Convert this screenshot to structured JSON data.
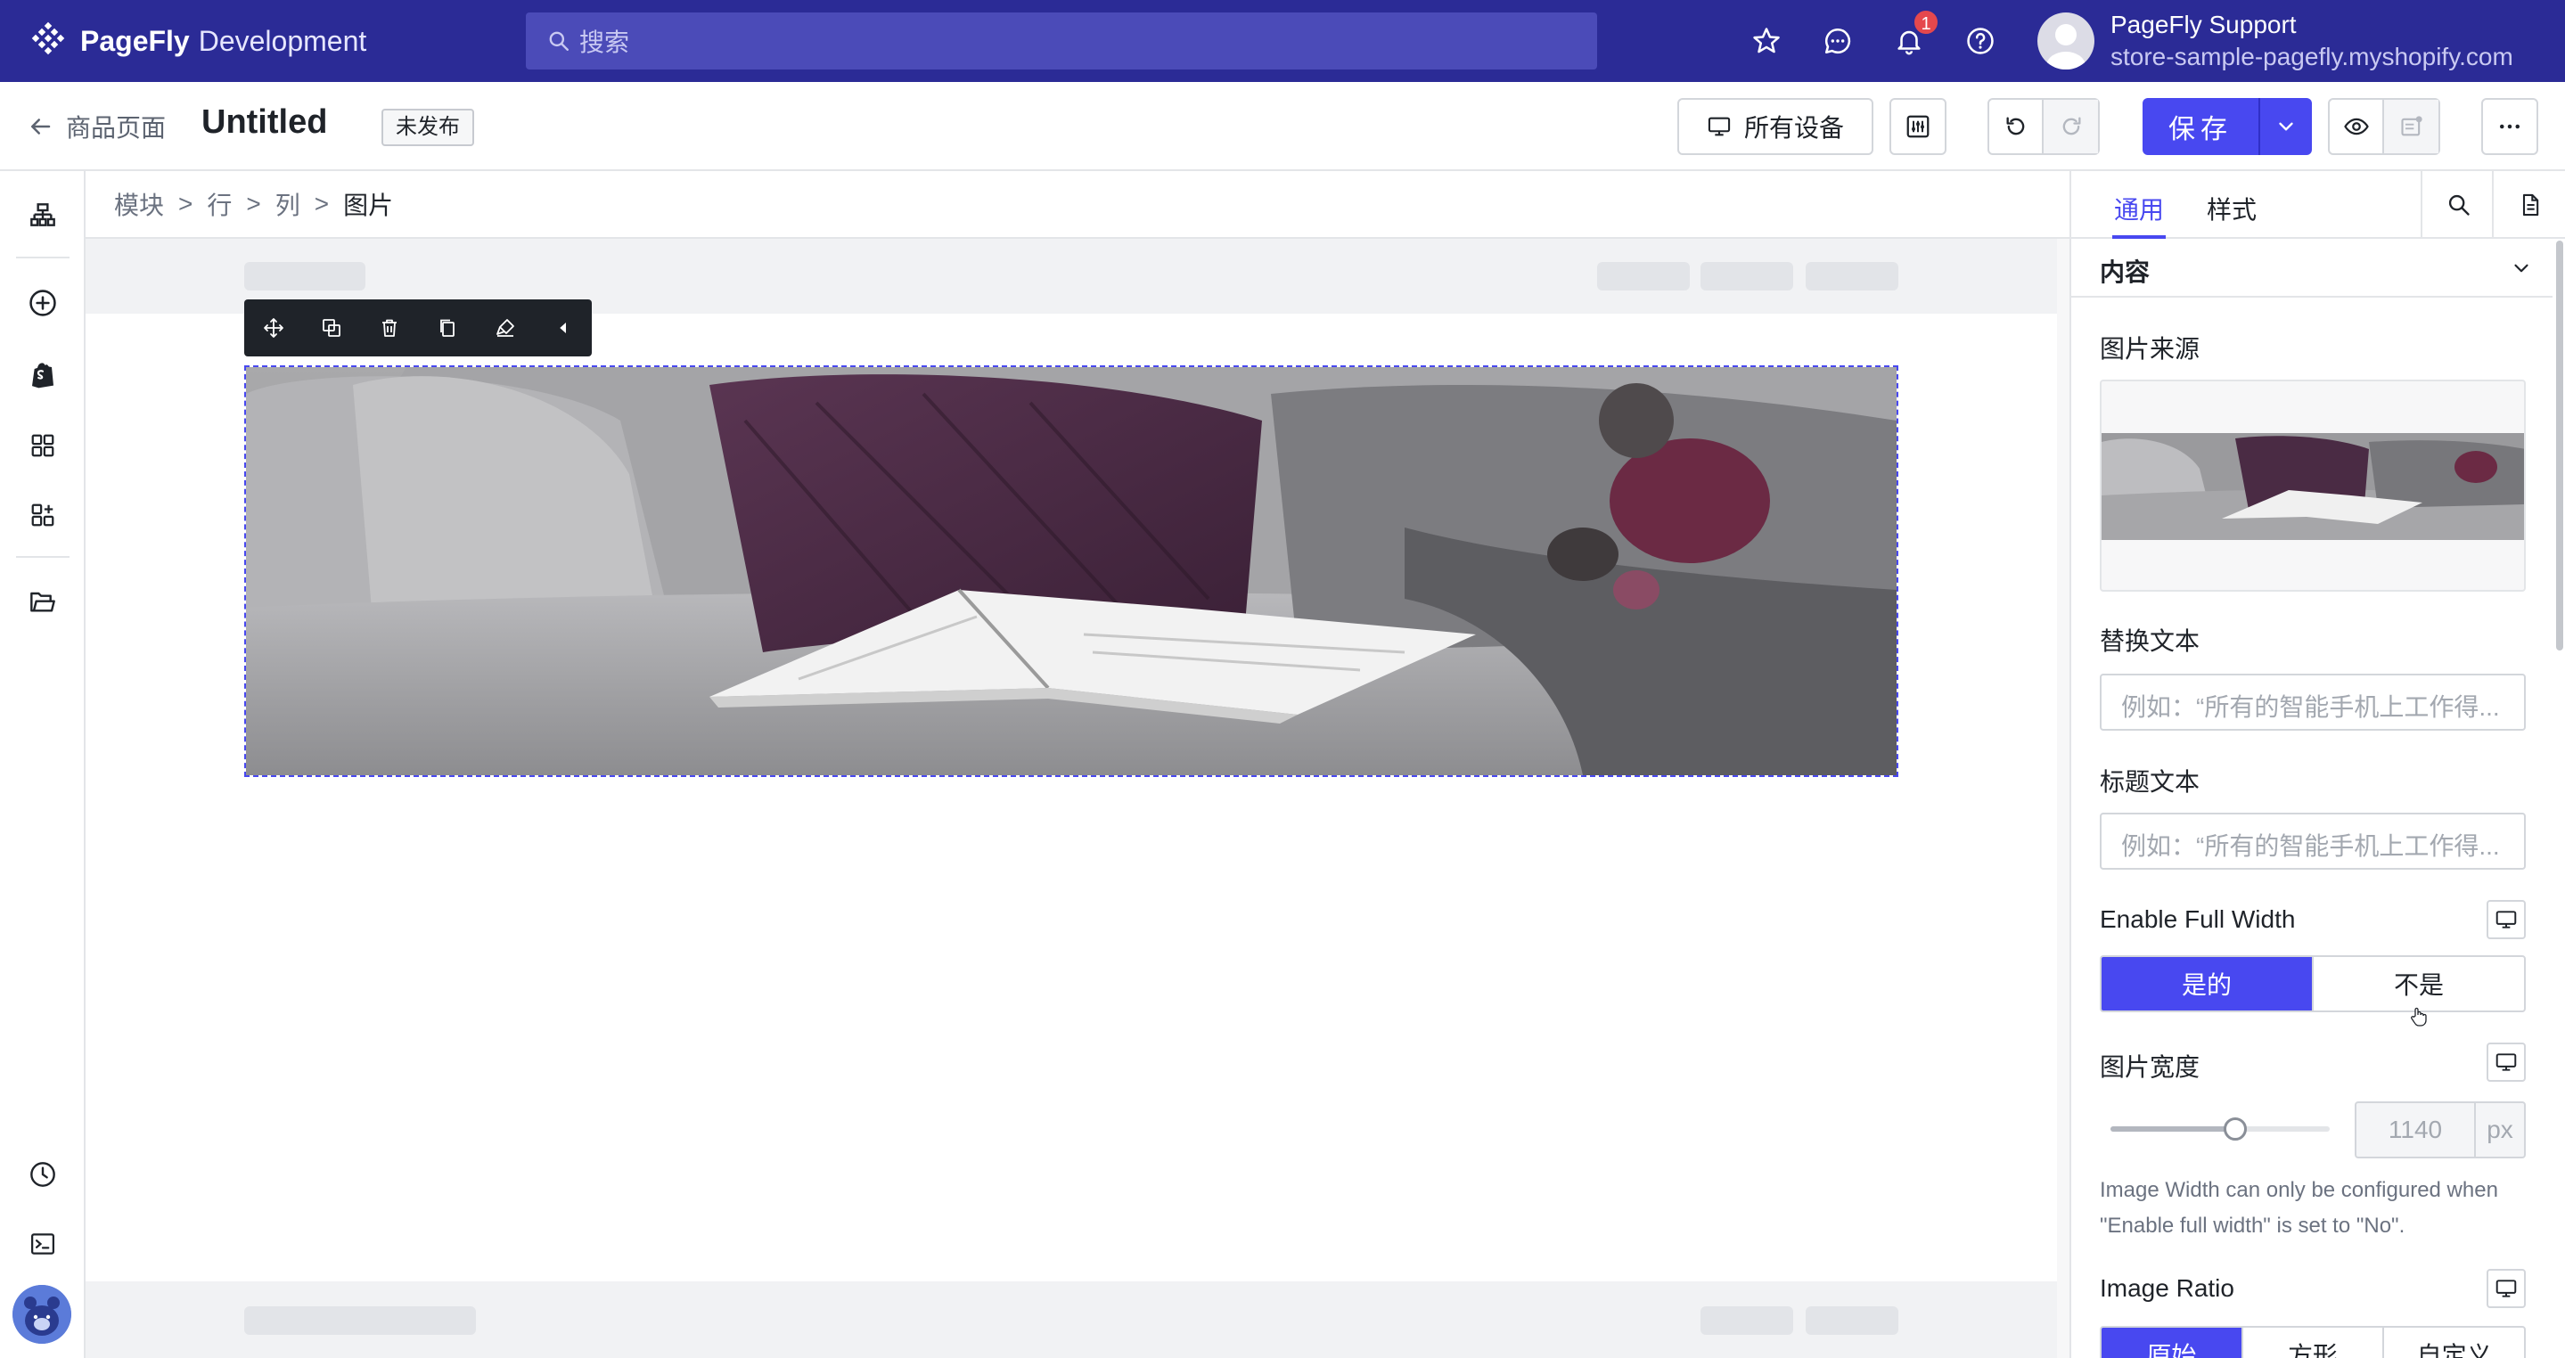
{
  "app": {
    "logo_text": "PageFly",
    "logo_sub": "Development",
    "search_placeholder": "搜索",
    "notification_count": "1",
    "user_name": "PageFly Support",
    "user_store": "store-sample-pagefly.myshopify.com"
  },
  "header": {
    "back_label": "商品页面",
    "title": "Untitled",
    "status": "未发布",
    "device_label": "所有设备",
    "save_label": "保存"
  },
  "breadcrumb": {
    "items": [
      "模块",
      "行",
      "列"
    ],
    "current": "图片"
  },
  "panel": {
    "tabs": [
      "通用",
      "样式"
    ],
    "section_title": "内容",
    "image_source_label": "图片来源",
    "alt_text_label": "替换文本",
    "alt_text_placeholder": "例如：“所有的智能手机上工作得...",
    "title_text_label": "标题文本",
    "title_text_placeholder": "例如：“所有的智能手机上工作得...",
    "full_width_label": "Enable Full Width",
    "full_width_options": [
      "是的",
      "不是"
    ],
    "full_width_selected": "是的",
    "image_width_label": "图片宽度",
    "image_width_value": "1140",
    "image_width_unit": "px",
    "image_width_slider_fraction": 0.57,
    "image_width_hint": "Image Width can only be configured when \"Enable full width\" is set to \"No\".",
    "image_ratio_label": "Image Ratio",
    "image_ratio_options": [
      "原始",
      "方形",
      "自定义"
    ],
    "image_ratio_selected": "原始"
  },
  "colors": {
    "topbar": "#2b2b96",
    "accent": "#4848f0",
    "badge": "#e5484d"
  }
}
